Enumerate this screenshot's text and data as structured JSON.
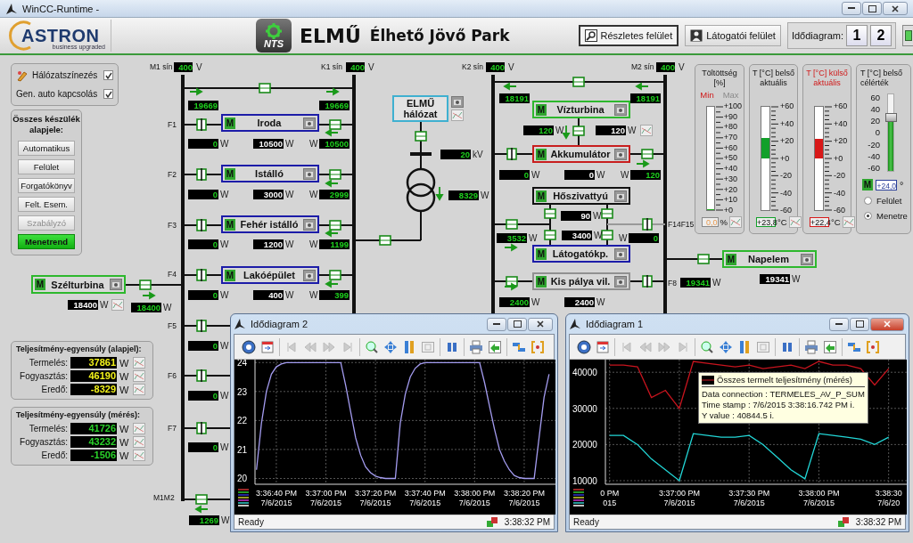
{
  "window": {
    "title": "WinCC-Runtime -"
  },
  "header": {
    "brand": "ASTRON",
    "tagline": "business upgraded",
    "badge_text": "NTS",
    "title": "ELMŰ",
    "subtitle": "Élhető Jövő Park",
    "buttons": [
      {
        "label": "Részletes felület",
        "selected": true
      },
      {
        "label": "Látogatói felület",
        "selected": false
      }
    ],
    "diagram_label": "Idődiagram:",
    "diagram_buttons": [
      "1",
      "2"
    ]
  },
  "options": [
    {
      "label": "Hálózatszínezés",
      "checked": true
    },
    {
      "label": "Gen. auto kapcsolás",
      "checked": true
    }
  ],
  "mode_group": {
    "title": "Összes készülék alapjele:",
    "buttons": [
      {
        "label": "Automatikus",
        "selected": false,
        "disabled": false
      },
      {
        "label": "Felület",
        "selected": false,
        "disabled": false
      },
      {
        "label": "Forgatókönyv",
        "selected": false,
        "disabled": false
      },
      {
        "label": "Felt. Esem.",
        "selected": false,
        "disabled": false
      },
      {
        "label": "Szabályzó",
        "selected": false,
        "disabled": true
      },
      {
        "label": "Menetrend",
        "selected": true,
        "disabled": false
      }
    ]
  },
  "balances": [
    {
      "title": "Teljesítmény-egyensúly (alapjel):",
      "kind": "setpoint",
      "rows": [
        {
          "label": "Termelés:",
          "value": "37861",
          "unit": "W"
        },
        {
          "label": "Fogyasztás:",
          "value": "46190",
          "unit": "W"
        },
        {
          "label": "Eredő:",
          "value": "-8329",
          "unit": "W"
        }
      ]
    },
    {
      "title": "Teljesítmény-egyensúly (mérés):",
      "kind": "measured",
      "rows": [
        {
          "label": "Termelés:",
          "value": "41726",
          "unit": "W"
        },
        {
          "label": "Fogyasztás:",
          "value": "43232",
          "unit": "W"
        },
        {
          "label": "Eredő:",
          "value": "-1506",
          "unit": "W"
        }
      ]
    }
  ],
  "diagram": {
    "buses": [
      {
        "label": "M1 sín",
        "value": "400",
        "unit": "V"
      },
      {
        "label": "K1 sín",
        "value": "400",
        "unit": "V"
      },
      {
        "label": "K2 sín",
        "value": "400",
        "unit": "V"
      },
      {
        "label": "M2 sín",
        "value": "400",
        "unit": "V"
      }
    ],
    "feeders": [
      "F1",
      "F2",
      "F3",
      "F4",
      "F5",
      "F6",
      "F7",
      "M1M2",
      "F14F15",
      "F8"
    ],
    "nodes": [
      {
        "kind": "device",
        "badge": "M",
        "label": "Iroda",
        "color": "#1c1ca8"
      },
      {
        "kind": "device",
        "badge": "M",
        "label": "Istálló",
        "color": "#1c1ca8"
      },
      {
        "kind": "device",
        "badge": "M",
        "label": "Fehér istálló",
        "color": "#1c1ca8"
      },
      {
        "kind": "device",
        "badge": "M",
        "label": "Lakóépület",
        "color": "#1c1ca8"
      },
      {
        "kind": "device",
        "badge": "M",
        "label": "Szélturbina",
        "color": "#2db82d"
      },
      {
        "kind": "grid",
        "label": "ELMŰ hálózat",
        "color": "#3fb0d0"
      },
      {
        "kind": "device",
        "badge": "M",
        "label": "Vízturbina",
        "color": "#2db82d"
      },
      {
        "kind": "device",
        "badge": "M",
        "label": "Akkumulátor",
        "color": "#c81e1e"
      },
      {
        "kind": "device",
        "badge": "M",
        "label": "Hőszivattyú",
        "color": "#111111"
      },
      {
        "kind": "device",
        "badge": "M",
        "label": "Látogatókp.",
        "color": "#1c1ca8"
      },
      {
        "kind": "device",
        "badge": "M",
        "label": "Kis pálya vil.",
        "color": "#909090"
      },
      {
        "kind": "device",
        "badge": "M",
        "label": "Napelem",
        "color": "#2db82d"
      }
    ],
    "readings": [
      {
        "value": "19669",
        "kind": "measured"
      },
      {
        "value": "19669",
        "kind": "measured"
      },
      {
        "value": "0",
        "unit": "W",
        "kind": "measured"
      },
      {
        "value": "10500",
        "unit": "W",
        "kind": "setpoint"
      },
      {
        "value": "10500",
        "unit": "W",
        "kind": "measured"
      },
      {
        "value": "0",
        "unit": "W",
        "kind": "measured"
      },
      {
        "value": "3000",
        "unit": "W",
        "kind": "setpoint"
      },
      {
        "value": "2999",
        "unit": "W",
        "kind": "measured"
      },
      {
        "value": "0",
        "unit": "W",
        "kind": "measured"
      },
      {
        "value": "1200",
        "unit": "W",
        "kind": "setpoint"
      },
      {
        "value": "1199",
        "unit": "W",
        "kind": "measured"
      },
      {
        "value": "0",
        "unit": "W",
        "kind": "measured"
      },
      {
        "value": "400",
        "unit": "W",
        "kind": "setpoint"
      },
      {
        "value": "399",
        "unit": "W",
        "kind": "measured"
      },
      {
        "value": "0",
        "unit": "W",
        "kind": "measured"
      },
      {
        "value": "0",
        "unit": "W",
        "kind": "measured"
      },
      {
        "value": "0",
        "unit": "W",
        "kind": "measured"
      },
      {
        "value": "1269",
        "unit": "W",
        "kind": "measured"
      },
      {
        "value": "18400",
        "unit": "W",
        "kind": "setpoint"
      },
      {
        "value": "18400",
        "unit": "W",
        "kind": "measured"
      },
      {
        "value": "20",
        "unit": "kV",
        "kind": "measured"
      },
      {
        "value": "8329",
        "unit": "W",
        "kind": "measured"
      },
      {
        "value": "18191",
        "kind": "measured"
      },
      {
        "value": "18191",
        "kind": "measured"
      },
      {
        "value": "120",
        "unit": "W",
        "kind": "measured"
      },
      {
        "value": "120",
        "unit": "W",
        "kind": "setpoint"
      },
      {
        "value": "0",
        "unit": "W",
        "kind": "measured"
      },
      {
        "value": "0",
        "unit": "W",
        "kind": "setpoint"
      },
      {
        "value": "120",
        "unit": "W",
        "kind": "measured"
      },
      {
        "value": "90",
        "unit": "W",
        "kind": "setpoint"
      },
      {
        "value": "3532",
        "unit": "W",
        "kind": "measured"
      },
      {
        "value": "3400",
        "unit": "W",
        "kind": "setpoint"
      },
      {
        "value": "0",
        "unit": "W",
        "kind": "measured"
      },
      {
        "value": "2400",
        "unit": "W",
        "kind": "measured"
      },
      {
        "value": "2400",
        "unit": "W",
        "kind": "setpoint"
      },
      {
        "value": "19341",
        "unit": "W",
        "kind": "measured"
      },
      {
        "value": "19341",
        "unit": "W",
        "kind": "setpoint"
      }
    ],
    "arrows": [
      {
        "kind": "right"
      },
      {
        "kind": "right"
      },
      {
        "kind": "left"
      },
      {
        "kind": "left"
      },
      {
        "kind": "left"
      },
      {
        "kind": "left"
      },
      {
        "kind": "right"
      },
      {
        "kind": "left"
      },
      {
        "kind": "down"
      },
      {
        "kind": "left"
      },
      {
        "kind": "left"
      },
      {
        "kind": "down"
      },
      {
        "kind": "right"
      },
      {
        "kind": "right"
      },
      {
        "kind": "right"
      }
    ]
  },
  "gauges": [
    {
      "kind": "level",
      "title": "Töltöttség [%]",
      "limits": [
        {
          "label": "Min",
          "active": true
        },
        {
          "label": "Max",
          "active": false
        }
      ],
      "ticks": [
        "+100",
        "+90",
        "+80",
        "+70",
        "+60",
        "+50",
        "+40",
        "+30",
        "+20",
        "+10",
        "+0"
      ],
      "level": 0,
      "reading": "0,0",
      "unit": "%"
    },
    {
      "kind": "thermo",
      "title": "T [°C] belső aktuális",
      "alert": false,
      "ticks": [
        "+60",
        "+40",
        "+20",
        "+0",
        "-20",
        "-40",
        "-60"
      ],
      "level": 0.7,
      "color": "#12a02a",
      "reading": "+23,8",
      "unit": "°C"
    },
    {
      "kind": "thermo",
      "title": "T [°C] külső aktuális",
      "alert": true,
      "ticks": [
        "+60",
        "+40",
        "+20",
        "+0",
        "-20",
        "-40",
        "-60"
      ],
      "level": 0.69,
      "color": "#d81818",
      "reading": "+22,4",
      "unit": "°C"
    },
    {
      "kind": "setpoint",
      "title": "T [°C] belső célérték",
      "ticks": [
        "60",
        "40",
        "20",
        "0",
        "-20",
        "-40",
        "-60"
      ],
      "level": 0.7,
      "badge": "M",
      "reading": "+24,0",
      "unit": "°",
      "options": [
        {
          "label": "Felület",
          "selected": false
        },
        {
          "label": "Menetre",
          "selected": true
        }
      ]
    }
  ],
  "trend_windows": [
    {
      "title": "Idődiagram 2",
      "status": "Ready",
      "time": "3:38:32 PM",
      "chart_data": {
        "type": "line",
        "categories": [
          null,
          null,
          null,
          null,
          "3:36:40 PM\n7/6/2015",
          null,
          null,
          null,
          null,
          null,
          null,
          null,
          null,
          null,
          "3:37:00 PM\n7/6/2015",
          null,
          null,
          null,
          null,
          null,
          null,
          null,
          null,
          null,
          "3:37:20 PM\n7/6/2015",
          null,
          null,
          null,
          null,
          null,
          null,
          null,
          null,
          null,
          "3:37:40 PM\n7/6/2015",
          null,
          null,
          null,
          null,
          null,
          null,
          null,
          null,
          null,
          "3:38:00 PM\n7/6/2015",
          null,
          null,
          null,
          null,
          null,
          null,
          null,
          null,
          null,
          "3:38:20 PM\n7/6/2015",
          null,
          null,
          null,
          null,
          null
        ],
        "series": [
          {
            "color": "#a49cf0",
            "values": [
              20.3,
              21.9,
              23.0,
              23.6,
              23.85,
              23.95,
              24,
              24,
              24,
              24,
              24,
              24,
              24,
              24,
              24,
              24,
              24,
              24,
              23.2,
              22.3,
              21.4,
              20.8,
              20.4,
              20.2,
              20.08,
              20.03,
              20,
              20,
              20,
              21.9,
              22.9,
              23.5,
              23.8,
              23.95,
              24,
              24,
              24,
              24,
              24,
              24,
              24,
              24,
              24,
              24,
              24,
              24,
              23.3,
              22.5,
              21.7,
              21.0,
              20.6,
              20.3,
              20.1,
              20.03,
              20,
              20,
              20,
              21.4,
              22.8,
              23.6
            ]
          }
        ],
        "ylim": [
          19.8,
          24.1
        ],
        "yticks": [
          20,
          21,
          22,
          23,
          24
        ],
        "grid": true
      }
    },
    {
      "title": "Idődiagram 1",
      "status": "Ready",
      "time": "3:38:32 PM",
      "chart_data": {
        "type": "line",
        "categories": [
          "0 PM\n015",
          null,
          null,
          null,
          null,
          "3:37:00 PM\n7/6/2015",
          null,
          null,
          null,
          null,
          "3:37:30 PM\n7/6/2015",
          null,
          null,
          null,
          null,
          "3:38:00 PM\n7/6/2015",
          null,
          null,
          null,
          null,
          "3:38:30\n7/6/20"
        ],
        "series": [
          {
            "color": "#c8141e",
            "values": [
              42000,
              42000,
              41500,
              33000,
              35000,
              30000,
              43000,
              42500,
              42000,
              41500,
              42000,
              41000,
              41500,
              42000,
              41000,
              43000,
              42000,
              42000,
              41000,
              36500,
              41000
            ]
          },
          {
            "color": "#22d6d6",
            "values": [
              22500,
              22500,
              20000,
              16000,
              13000,
              10000,
              23000,
              22500,
              22000,
              22000,
              22500,
              20000,
              16500,
              13000,
              10500,
              23000,
              22500,
              22000,
              21500,
              20000,
              22000
            ]
          }
        ],
        "ylim": [
          9000,
          43500
        ],
        "yticks": [
          10000,
          20000,
          30000,
          40000
        ],
        "grid": true
      },
      "tooltip": {
        "title": "Összes termelt teljesítmény (mérés)",
        "lines": [
          "Data connection : TERMELES_AV_P_SUM",
          "Time stamp : 7/6/2015 3:38:16.742 PM i.",
          "Y value : 40844.5 i."
        ]
      }
    }
  ]
}
